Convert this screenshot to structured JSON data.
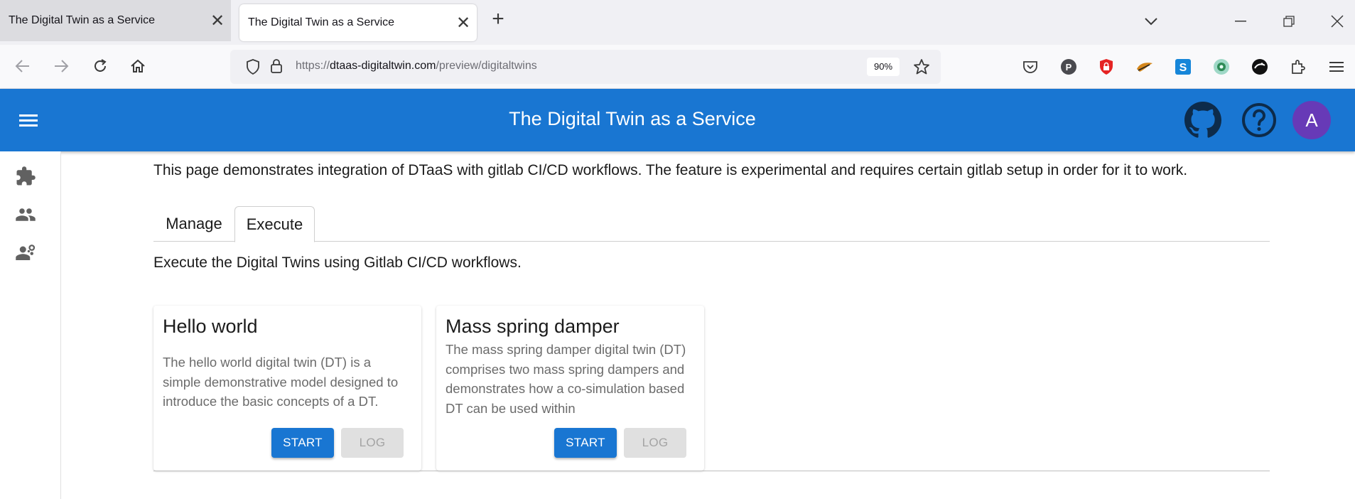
{
  "browser": {
    "tabs": [
      {
        "title": "The Digital Twin as a Service",
        "active": false
      },
      {
        "title": "The Digital Twin as a Service",
        "active": true
      }
    ],
    "url": {
      "prefix": "https://",
      "host": "dtaas-digitaltwin.com",
      "path": "/preview/digitaltwins"
    },
    "zoom": "90%",
    "extensions": [
      "pocket-icon",
      "p-extension-icon",
      "shield-extension-icon",
      "bird-extension-icon",
      "s-extension-icon",
      "eye-extension-icon",
      "dark-extension-icon",
      "puzzle-icon",
      "hamburger-icon"
    ]
  },
  "app": {
    "title": "The Digital Twin as a Service",
    "avatar_letter": "A",
    "brand_color": "#1976d2",
    "avatar_color": "#673ab7"
  },
  "sidebar": {
    "items": [
      {
        "icon": "puzzle-piece-icon"
      },
      {
        "icon": "people-icon"
      },
      {
        "icon": "engineering-icon"
      }
    ]
  },
  "main": {
    "intro": "This page demonstrates integration of DTaaS with gitlab CI/CD workflows. The feature is experimental and requires certain gitlab setup in order for it to work.",
    "tabs": [
      {
        "label": "Manage",
        "selected": false
      },
      {
        "label": "Execute",
        "selected": true
      }
    ],
    "subtitle": "Execute the Digital Twins using Gitlab CI/CD workflows.",
    "cards": [
      {
        "title": "Hello world",
        "description": "The hello world digital twin (DT) is a simple demonstrative model designed to introduce the basic concepts of a DT.",
        "start_label": "START",
        "log_label": "LOG"
      },
      {
        "title": "Mass spring damper",
        "description": "The mass spring damper digital twin (DT) comprises two mass spring dampers and demonstrates how a co-simulation based DT can be used within",
        "start_label": "START",
        "log_label": "LOG"
      }
    ]
  }
}
